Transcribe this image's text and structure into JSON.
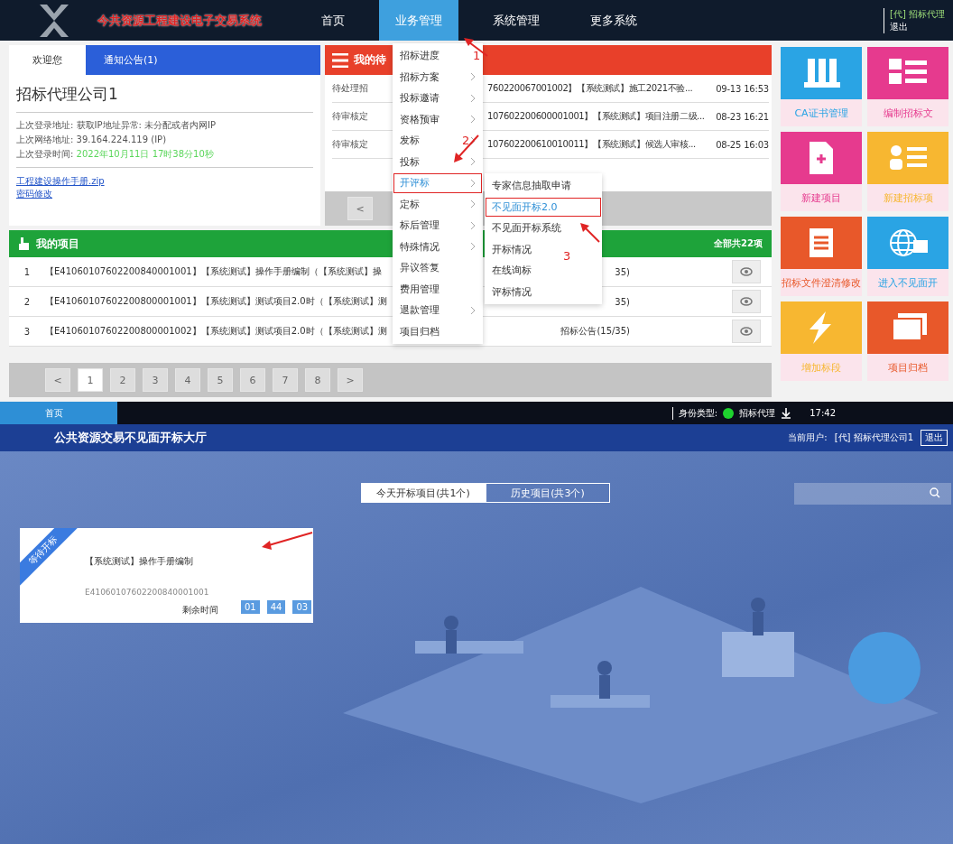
{
  "header": {
    "title": "今共资源工程建设电子交易系统",
    "nav": [
      {
        "label": "首页",
        "selected": false
      },
      {
        "label": "业务管理",
        "selected": true
      },
      {
        "label": "系统管理",
        "selected": false
      },
      {
        "label": "更多系统",
        "selected": false
      }
    ],
    "user": "[代] 招标代理",
    "logout": "退出"
  },
  "welcome": {
    "tabs": [
      {
        "label": "欢迎您",
        "selected": true
      },
      {
        "label": "通知公告(1)",
        "selected": false
      }
    ],
    "company": "招标代理公司1",
    "info": [
      {
        "label": "上次登录地址:",
        "value": "获取IP地址异常: 未分配或者内网IP",
        "kind": "plain"
      },
      {
        "label": "上次网络地址:",
        "value": "39.164.224.119 (IP)",
        "kind": "plain"
      },
      {
        "label": "上次登录时间:",
        "value": "2022年10月11日 17时38分10秒",
        "kind": "highlight"
      }
    ],
    "links": [
      "工程建设操作手册.zip",
      "密码修改"
    ]
  },
  "todo": {
    "title": "我的待",
    "rows": [
      {
        "status": "待处理招",
        "text": "760220067001002】【系统测试】施工2021不验...",
        "time": "09-13 16:53"
      },
      {
        "status": "待审核定",
        "text": "107602200600001001】【系统测试】项目注册二级...",
        "time": "08-23 16:21"
      },
      {
        "status": "待审核定",
        "text": "107602200610010011】【系统测试】候选人审核...",
        "time": "08-25 16:03"
      }
    ],
    "pager": "<"
  },
  "menu": {
    "items": [
      {
        "label": "招标进度",
        "arrow": false,
        "selected": false
      },
      {
        "label": "招标方案",
        "arrow": true,
        "selected": false
      },
      {
        "label": "投标邀请",
        "arrow": true,
        "selected": false
      },
      {
        "label": "资格预审",
        "arrow": true,
        "selected": false
      },
      {
        "label": "发标",
        "arrow": true,
        "selected": false
      },
      {
        "label": "投标",
        "arrow": true,
        "selected": false
      },
      {
        "label": "开评标",
        "arrow": true,
        "selected": true
      },
      {
        "label": "定标",
        "arrow": true,
        "selected": false
      },
      {
        "label": "标后管理",
        "arrow": true,
        "selected": false
      },
      {
        "label": "特殊情况",
        "arrow": true,
        "selected": false
      },
      {
        "label": "异议答复",
        "arrow": false,
        "selected": false
      },
      {
        "label": "费用管理",
        "arrow": false,
        "selected": false
      },
      {
        "label": "退款管理",
        "arrow": true,
        "selected": false
      },
      {
        "label": "项目归档",
        "arrow": false,
        "selected": false
      }
    ],
    "submenu": [
      {
        "label": "专家信息抽取申请",
        "selected": false
      },
      {
        "label": "不见面开标2.0",
        "selected": true
      },
      {
        "label": "不见面开标系统",
        "selected": false
      },
      {
        "label": "开标情况",
        "selected": false
      },
      {
        "label": "在线询标",
        "selected": false
      },
      {
        "label": "评标情况",
        "selected": false
      }
    ]
  },
  "annotations": [
    "1",
    "2",
    "3"
  ],
  "projects": {
    "title": "我的项目",
    "total": "全部共22项",
    "rows": [
      {
        "index": "1",
        "text": "【E41060107602200840001001】【系统测试】操作手册编制（【系统测试】操",
        "status": "35)"
      },
      {
        "index": "2",
        "text": "【E41060107602200800001001】【系统测试】测试项目2.0时（【系统测试】测",
        "status": "35)"
      },
      {
        "index": "3",
        "text": "【E41060107602200800001002】【系统测试】测试项目2.0时（【系统测试】测",
        "status": "招标公告(15/35)"
      }
    ]
  },
  "pagination": [
    {
      "label": "<",
      "selected": false
    },
    {
      "label": "1",
      "selected": true
    },
    {
      "label": "2",
      "selected": false
    },
    {
      "label": "3",
      "selected": false
    },
    {
      "label": "4",
      "selected": false
    },
    {
      "label": "5",
      "selected": false
    },
    {
      "label": "6",
      "selected": false
    },
    {
      "label": "7",
      "selected": false
    },
    {
      "label": "8",
      "selected": false
    },
    {
      "label": ">",
      "selected": false
    }
  ],
  "tiles": [
    {
      "label": "CA证书管理",
      "color": "#2aa4e4",
      "kind": "keys"
    },
    {
      "label": "编制招标文",
      "color": "#e63a8e",
      "kind": "list"
    },
    {
      "label": "新建项目",
      "color": "#e63a8e",
      "kind": "doc"
    },
    {
      "label": "新建招标项",
      "color": "#f7b731",
      "kind": "person"
    },
    {
      "label": "招标文件澄清修改",
      "color": "#e8582a",
      "kind": "notepad"
    },
    {
      "label": "进入不见面开",
      "color": "#2aa4e4",
      "kind": "globe"
    },
    {
      "label": "增加标段",
      "color": "#f7b731",
      "kind": "bolt"
    },
    {
      "label": "项目归档",
      "color": "#e8582a",
      "kind": "stack"
    }
  ],
  "hall": {
    "nav_tab": "首页",
    "identity_label": "身份类型:",
    "identity": "招标代理",
    "time": "17:42",
    "title": "公共资源交易不见面开标大厅",
    "user_label": "当前用户:",
    "user": "[代] 招标代理公司1",
    "logout": "退出",
    "tabs": [
      {
        "label": "今天开标项目(共1个)",
        "selected": true
      },
      {
        "label": "历史项目(共3个)",
        "selected": false
      }
    ],
    "card": {
      "badge": "等待开标",
      "title": "【系统测试】操作手册编制",
      "code": "E41060107602200840001001",
      "countdown_label": "剩余时间",
      "countdown": [
        "01",
        "44",
        "03"
      ]
    }
  }
}
